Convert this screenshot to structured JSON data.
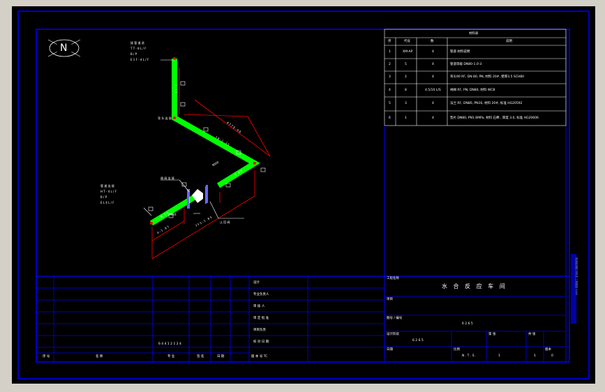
{
  "drawing": {
    "north_label": "N",
    "title": "水 合 反 应 车 间",
    "drawing_no": "6 2 6 5",
    "project_no": "6 2 6 5",
    "scale": "N . T . S .",
    "sheet": "1",
    "sheets": "1",
    "rev": "0",
    "left_code": "6 4 4 1 2 1 2 4",
    "colors": {
      "background": "#000000",
      "frame": "#0000ff",
      "pipe": "#00ff00",
      "dimension": "#ff0000",
      "text": "#ffffff"
    }
  },
  "legend": {
    "header": "材料表",
    "columns": [
      "序",
      "代号",
      "数",
      "说明"
    ],
    "rows": [
      {
        "no": "1",
        "code": "XM-AP",
        "qty": "4",
        "desc": "管道 材料说明"
      },
      {
        "no": "2",
        "code": "5",
        "qty": "4",
        "desc": "管道等级 DN80-1.0-3"
      },
      {
        "no": "3",
        "code": "2",
        "qty": "4",
        "desc": "弯头90 RF, DN 80, PN, 材料 20#, 壁厚3.5 SCH80"
      },
      {
        "no": "4",
        "code": "8",
        "qty": "4.5/10 L/S",
        "desc": "闸阀 RF, PN, DN80, 材料 WCB"
      },
      {
        "no": "5",
        "code": "3",
        "qty": "4",
        "desc": "法兰 RF, DN80, PN16, 材料 20#, 标准 HG20592"
      },
      {
        "no": "6",
        "code": "1",
        "qty": "4",
        "desc": "垫片 DN80, PN1.6MPa, 材料 石棉 , 厚度 3.0, 标准 HG20606"
      }
    ]
  },
  "pipe_notes": {
    "top_note": [
      "接 管 道 进",
      "T T - 8 L / F",
      "B / P",
      "E 1 F - 4 L / F"
    ],
    "left_note": [
      "管 道 连 接",
      "H T - 4 L / F",
      "B / P",
      "E L 4 L / F"
    ],
    "seg_top_vertical": "1 . 1 5",
    "seg_diagonal": "7 8 - 1 . 3 5",
    "seg_upper_right": "3 . 0 0",
    "seg_lower_left": "8 . 1 5",
    "seg_lower_right": "8 . 1 5",
    "dim_long": "4 7 7 5 - 0 8",
    "dim_short": "4 - 1 . 6 7",
    "dim_mid": "7 F 5 - 1 . 6 5",
    "valve_label_left": "闸 阀 连 接",
    "valve_label_right": "止 回 阀",
    "elbow_label": "弯 头 连 接",
    "label_8000": "8000",
    "label_pn": "PN16"
  },
  "title_block": {
    "sign_labels": [
      "设计",
      "专业负责人",
      "审 核 人",
      "审 定 批 准",
      "项目负责",
      "校 对 日 期"
    ],
    "footer_cells": [
      "序 号",
      "名 称",
      "专 业",
      "签 名",
      "日 期",
      "版 本 号 TC"
    ],
    "right_labels": {
      "project": "工程名称",
      "item": "项目",
      "drawing_no": "图号 / 编号",
      "design_stage": "设计阶段",
      "date": "日期",
      "scale": "比例",
      "sheet": "第 张",
      "sheets": "共 张",
      "rev": "版本"
    }
  },
  "side_vertical_text": "管道轴测图 材料表 工程图纸 6265"
}
